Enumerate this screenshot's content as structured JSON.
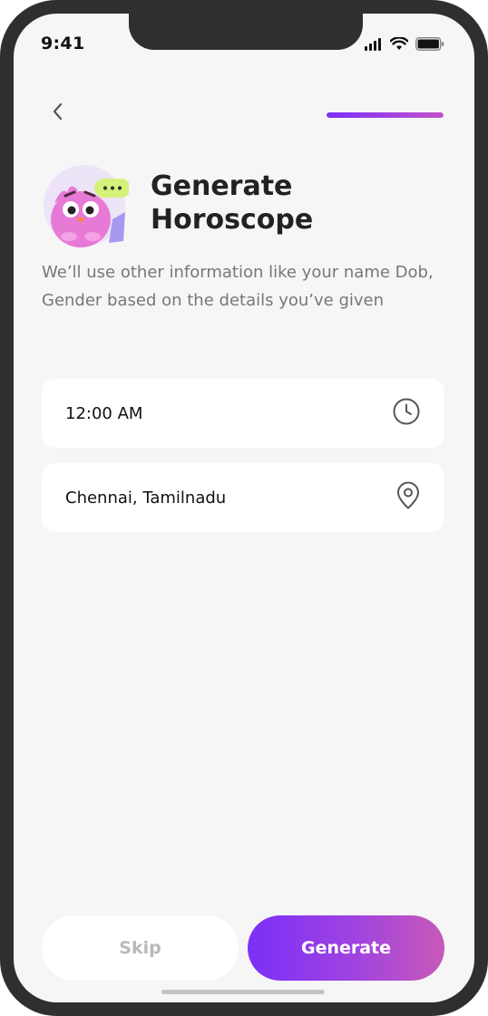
{
  "status_bar": {
    "time": "9:41",
    "icons": [
      "signal-icon",
      "wifi-icon",
      "battery-icon"
    ]
  },
  "header": {
    "back_icon": "chevron-left-icon",
    "progress": 1.0,
    "progress_colors": [
      "#7b2ff7",
      "#c254c9"
    ]
  },
  "title": "Generate Horoscope",
  "description": "We’ll use other information like your name Dob, Gender based on the details you’ve given",
  "fields": {
    "time": {
      "value": "12:00 AM",
      "icon": "clock-icon"
    },
    "location": {
      "value": "Chennai, Tamilnadu",
      "icon": "location-pin-icon"
    }
  },
  "buttons": {
    "skip_label": "Skip",
    "generate_label": "Generate"
  },
  "colors": {
    "accent_start": "#7b2ff7",
    "accent_end": "#c95ab8",
    "background": "#f6f6f6"
  }
}
